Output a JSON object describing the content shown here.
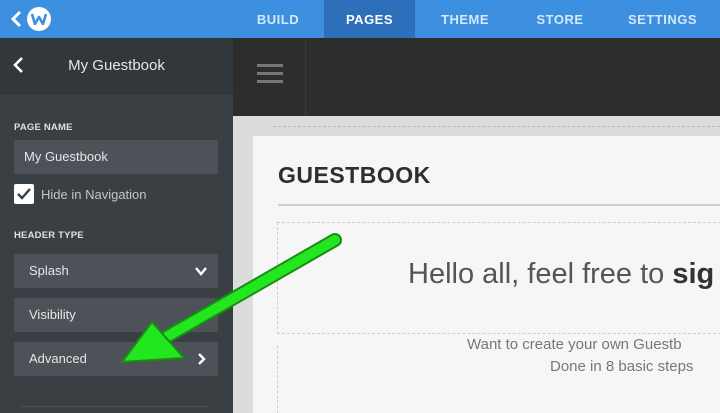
{
  "topbar": {
    "nav": [
      {
        "label": "BUILD",
        "active": false
      },
      {
        "label": "PAGES",
        "active": true
      },
      {
        "label": "THEME",
        "active": false
      },
      {
        "label": "STORE",
        "active": false
      },
      {
        "label": "SETTINGS",
        "active": false
      }
    ],
    "accent": "#3d8fe0"
  },
  "sidebar": {
    "title": "My Guestbook",
    "page_name_label": "PAGE NAME",
    "page_name_value": "My Guestbook",
    "hide_in_nav_label": "Hide in Navigation",
    "hide_in_nav_checked": true,
    "header_type_label": "HEADER TYPE",
    "header_type_value": "Splash",
    "visibility_label": "Visibility",
    "advanced_label": "Advanced"
  },
  "canvas": {
    "title": "GUESTBOOK",
    "hello_text": "Hello all, feel free to ",
    "hello_bold": "sig",
    "want_text": "Want to create your own Guestb",
    "done_text": "Done in 8 basic steps"
  },
  "annotation": {
    "arrow_color": "#22e61e"
  }
}
